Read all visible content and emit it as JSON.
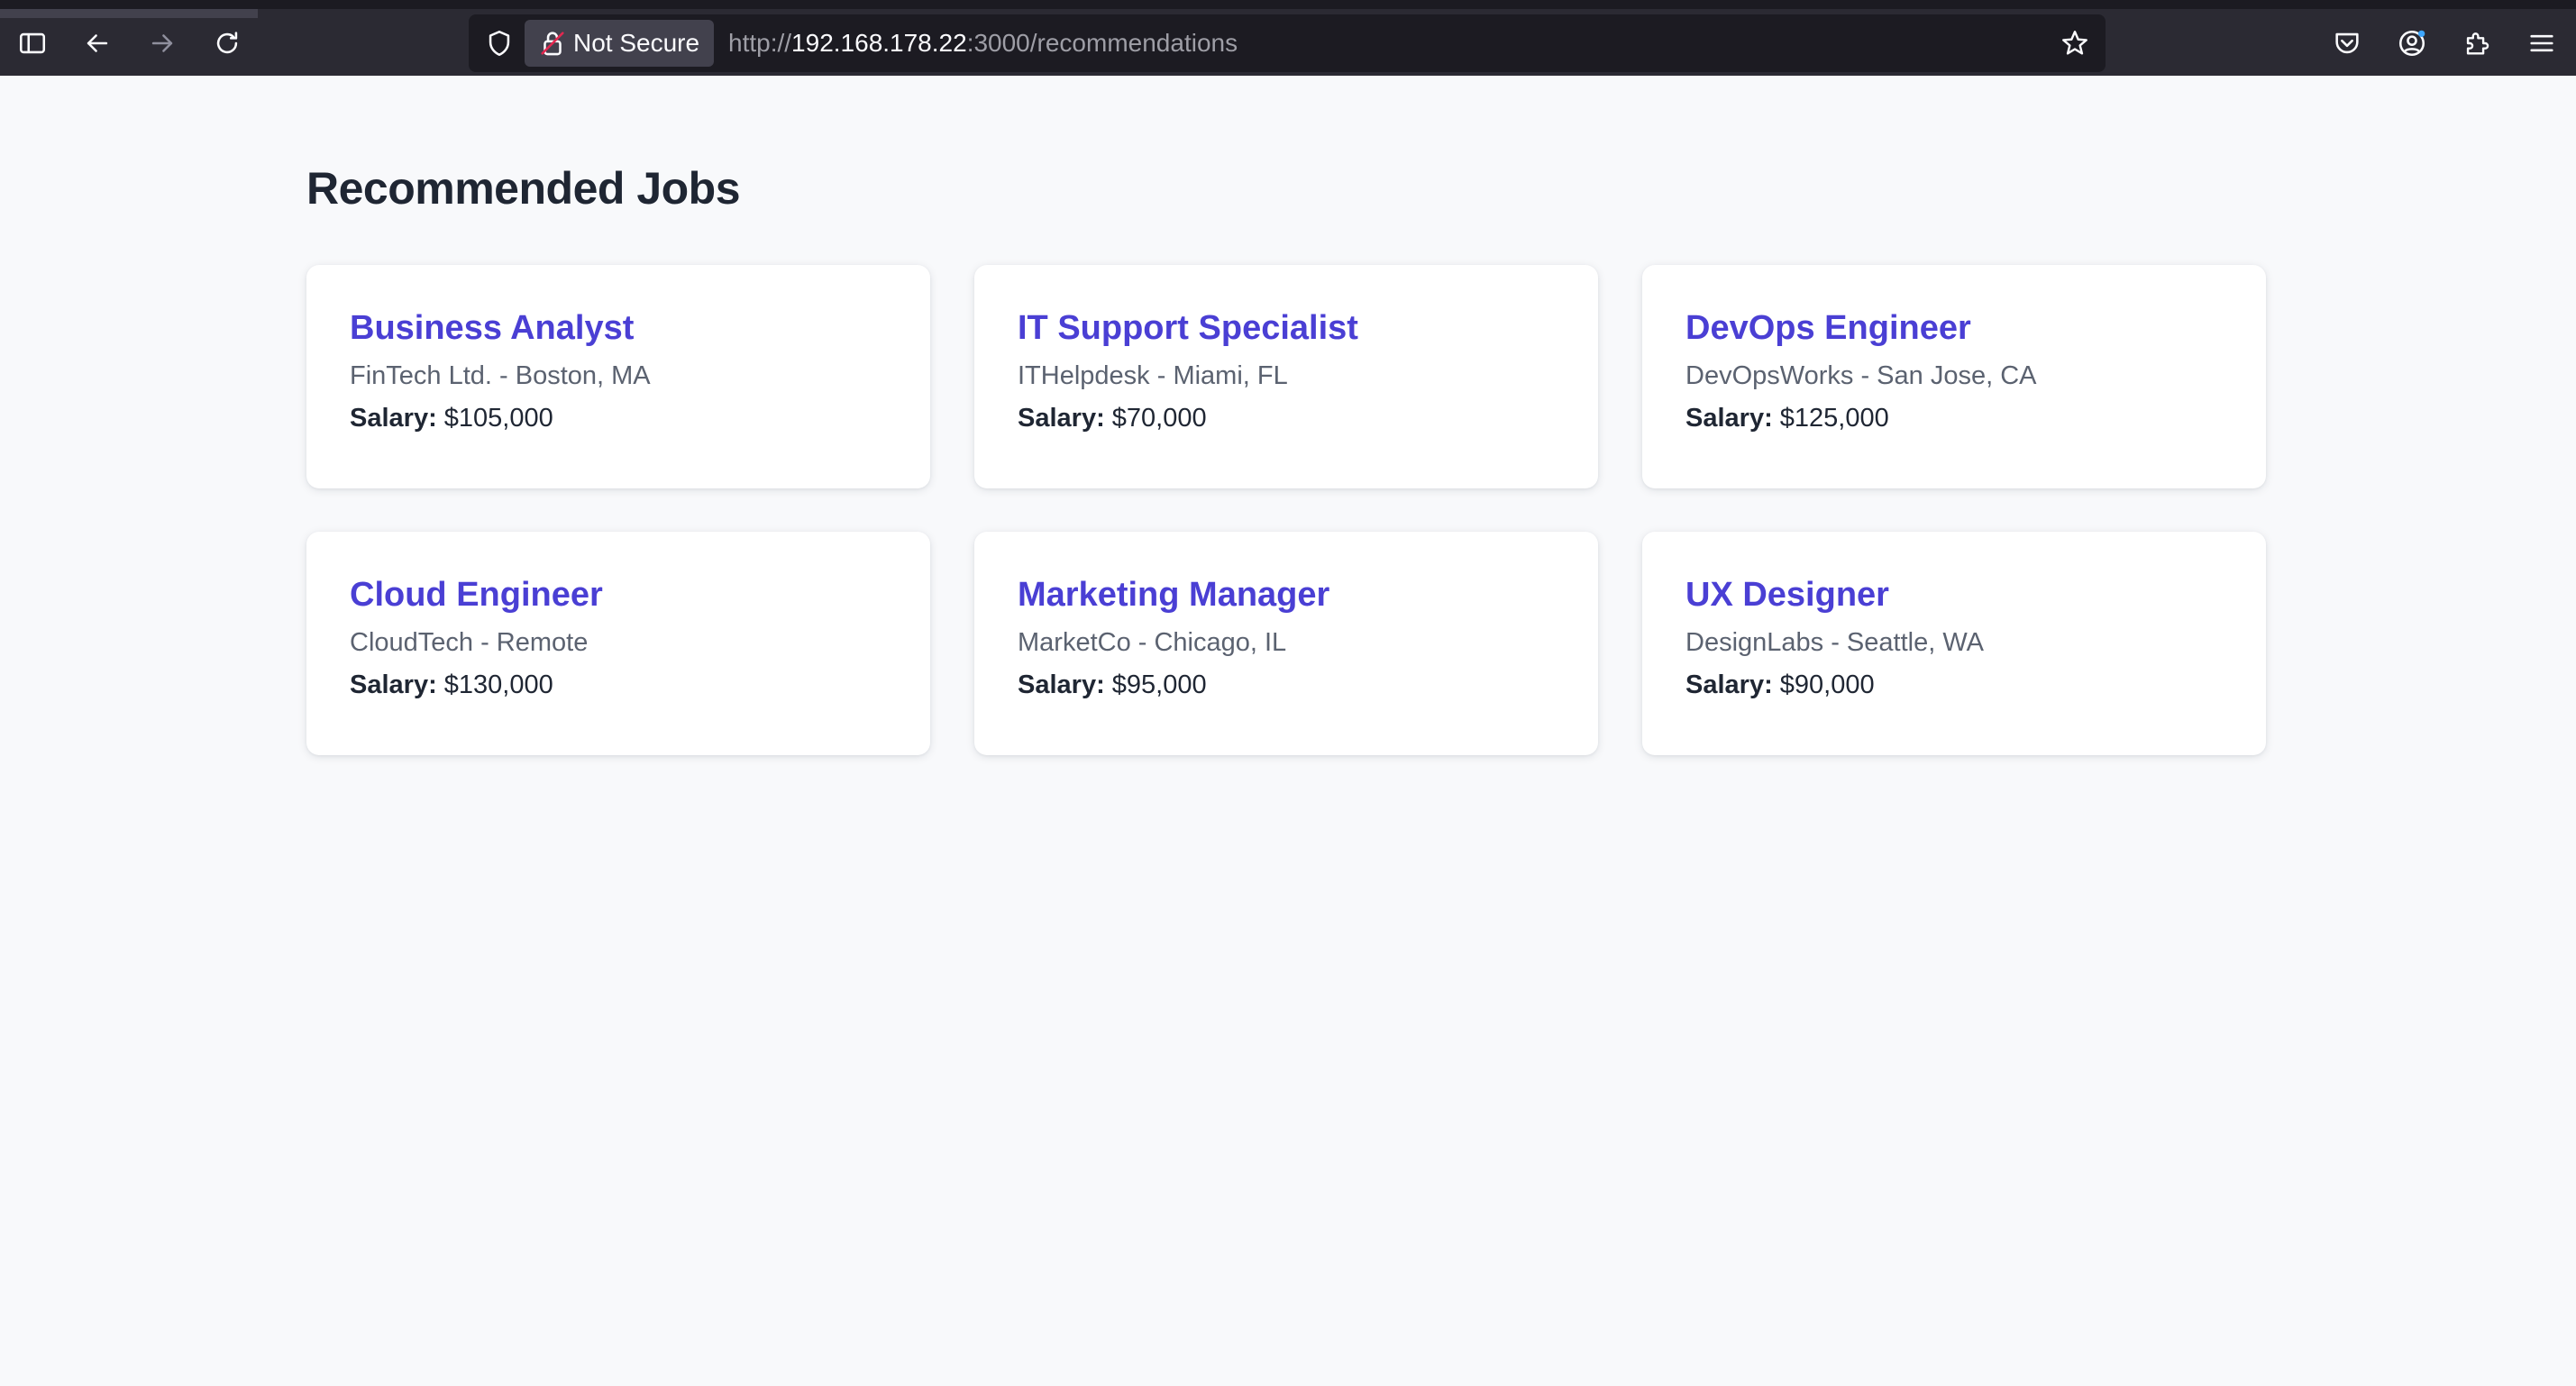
{
  "browser": {
    "security_label": "Not Secure",
    "url_scheme": "http://",
    "url_host": "192.168.178.22",
    "url_rest": ":3000/recommendations"
  },
  "page": {
    "title": "Recommended Jobs"
  },
  "jobs": [
    {
      "title": "Business Analyst",
      "meta": "FinTech Ltd. - Boston, MA",
      "salary_label": "Salary:",
      "salary": "$105,000"
    },
    {
      "title": "IT Support Specialist",
      "meta": "ITHelpdesk - Miami, FL",
      "salary_label": "Salary:",
      "salary": "$70,000"
    },
    {
      "title": "DevOps Engineer",
      "meta": "DevOpsWorks - San Jose, CA",
      "salary_label": "Salary:",
      "salary": "$125,000"
    },
    {
      "title": "Cloud Engineer",
      "meta": "CloudTech - Remote",
      "salary_label": "Salary:",
      "salary": "$130,000"
    },
    {
      "title": "Marketing Manager",
      "meta": "MarketCo - Chicago, IL",
      "salary_label": "Salary:",
      "salary": "$95,000"
    },
    {
      "title": "UX Designer",
      "meta": "DesignLabs - Seattle, WA",
      "salary_label": "Salary:",
      "salary": "$90,000"
    }
  ],
  "colors": {
    "accent": "#4a3fd4",
    "heading": "#1f2633",
    "muted": "#5b6270",
    "page_bg": "#f8f9fb",
    "toolbar_bg": "#2b2a33",
    "notification_dot": "#3ea6ff"
  },
  "icons": {
    "sidebar": "sidebar-icon",
    "back": "arrow-left-icon",
    "forward": "arrow-right-icon",
    "reload": "reload-icon",
    "tracking": "shield-icon",
    "insecure": "broken-lock-icon",
    "bookmark": "star-icon",
    "pocket": "pocket-icon",
    "account": "account-icon",
    "extensions": "puzzle-icon",
    "menu": "hamburger-menu-icon"
  }
}
